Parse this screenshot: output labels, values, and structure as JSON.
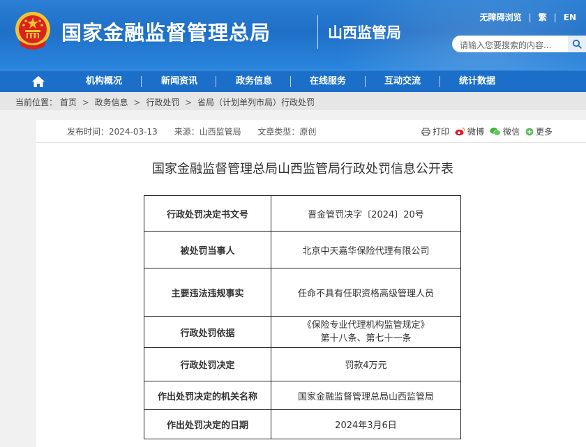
{
  "header": {
    "site_title": "国家金融监督管理总局",
    "sub_title": "山西监管局",
    "top_links": [
      "无障碍浏览",
      "繁",
      "EN"
    ],
    "search_placeholder": "请输入您要搜索的内容..."
  },
  "nav": {
    "items": [
      "机构概况",
      "新闻资讯",
      "政务信息",
      "在线服务",
      "互动交流",
      "统计数据"
    ]
  },
  "breadcrumb": {
    "label": "当前位置：",
    "items": [
      "首页",
      "政务信息",
      "行政处罚",
      "省局（计划单列市局）行政处罚"
    ]
  },
  "meta": {
    "publish_time": "发布时间：2024-03-13",
    "source": "来源：山西监管局",
    "type": "文章类型：原创"
  },
  "share": {
    "print": "打印",
    "weibo": "微博",
    "wechat": "微信",
    "more": "更多"
  },
  "doc_title": "国家金融监督管理总局山西监管局行政处罚信息公开表",
  "table": {
    "rows": [
      {
        "key": "行政处罚决定书文号",
        "value": "晋金管罚决字〔2024〕20号"
      },
      {
        "key": "被处罚当事人",
        "value": "北京中天嘉华保险代理有限公司"
      },
      {
        "key": "主要违法违规事实",
        "value": "任命不具有任职资格高级管理人员"
      },
      {
        "key": "行政处罚依据",
        "value": "《保险专业代理机构监管规定》",
        "value2": "第十八条、第七十一条"
      },
      {
        "key": "行政处罚决定",
        "value": "罚款4万元"
      },
      {
        "key": "作出处罚决定的机关名称",
        "value": "国家金融监督管理总局山西监管局"
      },
      {
        "key": "作出处罚决定的日期",
        "value": "2024年3月6日"
      }
    ]
  },
  "colors": {
    "header_blue": "#1f6fc6",
    "nav_blue": "#1b6fc8",
    "emblem_red": "#d9231f",
    "emblem_gold": "#f4c430"
  }
}
